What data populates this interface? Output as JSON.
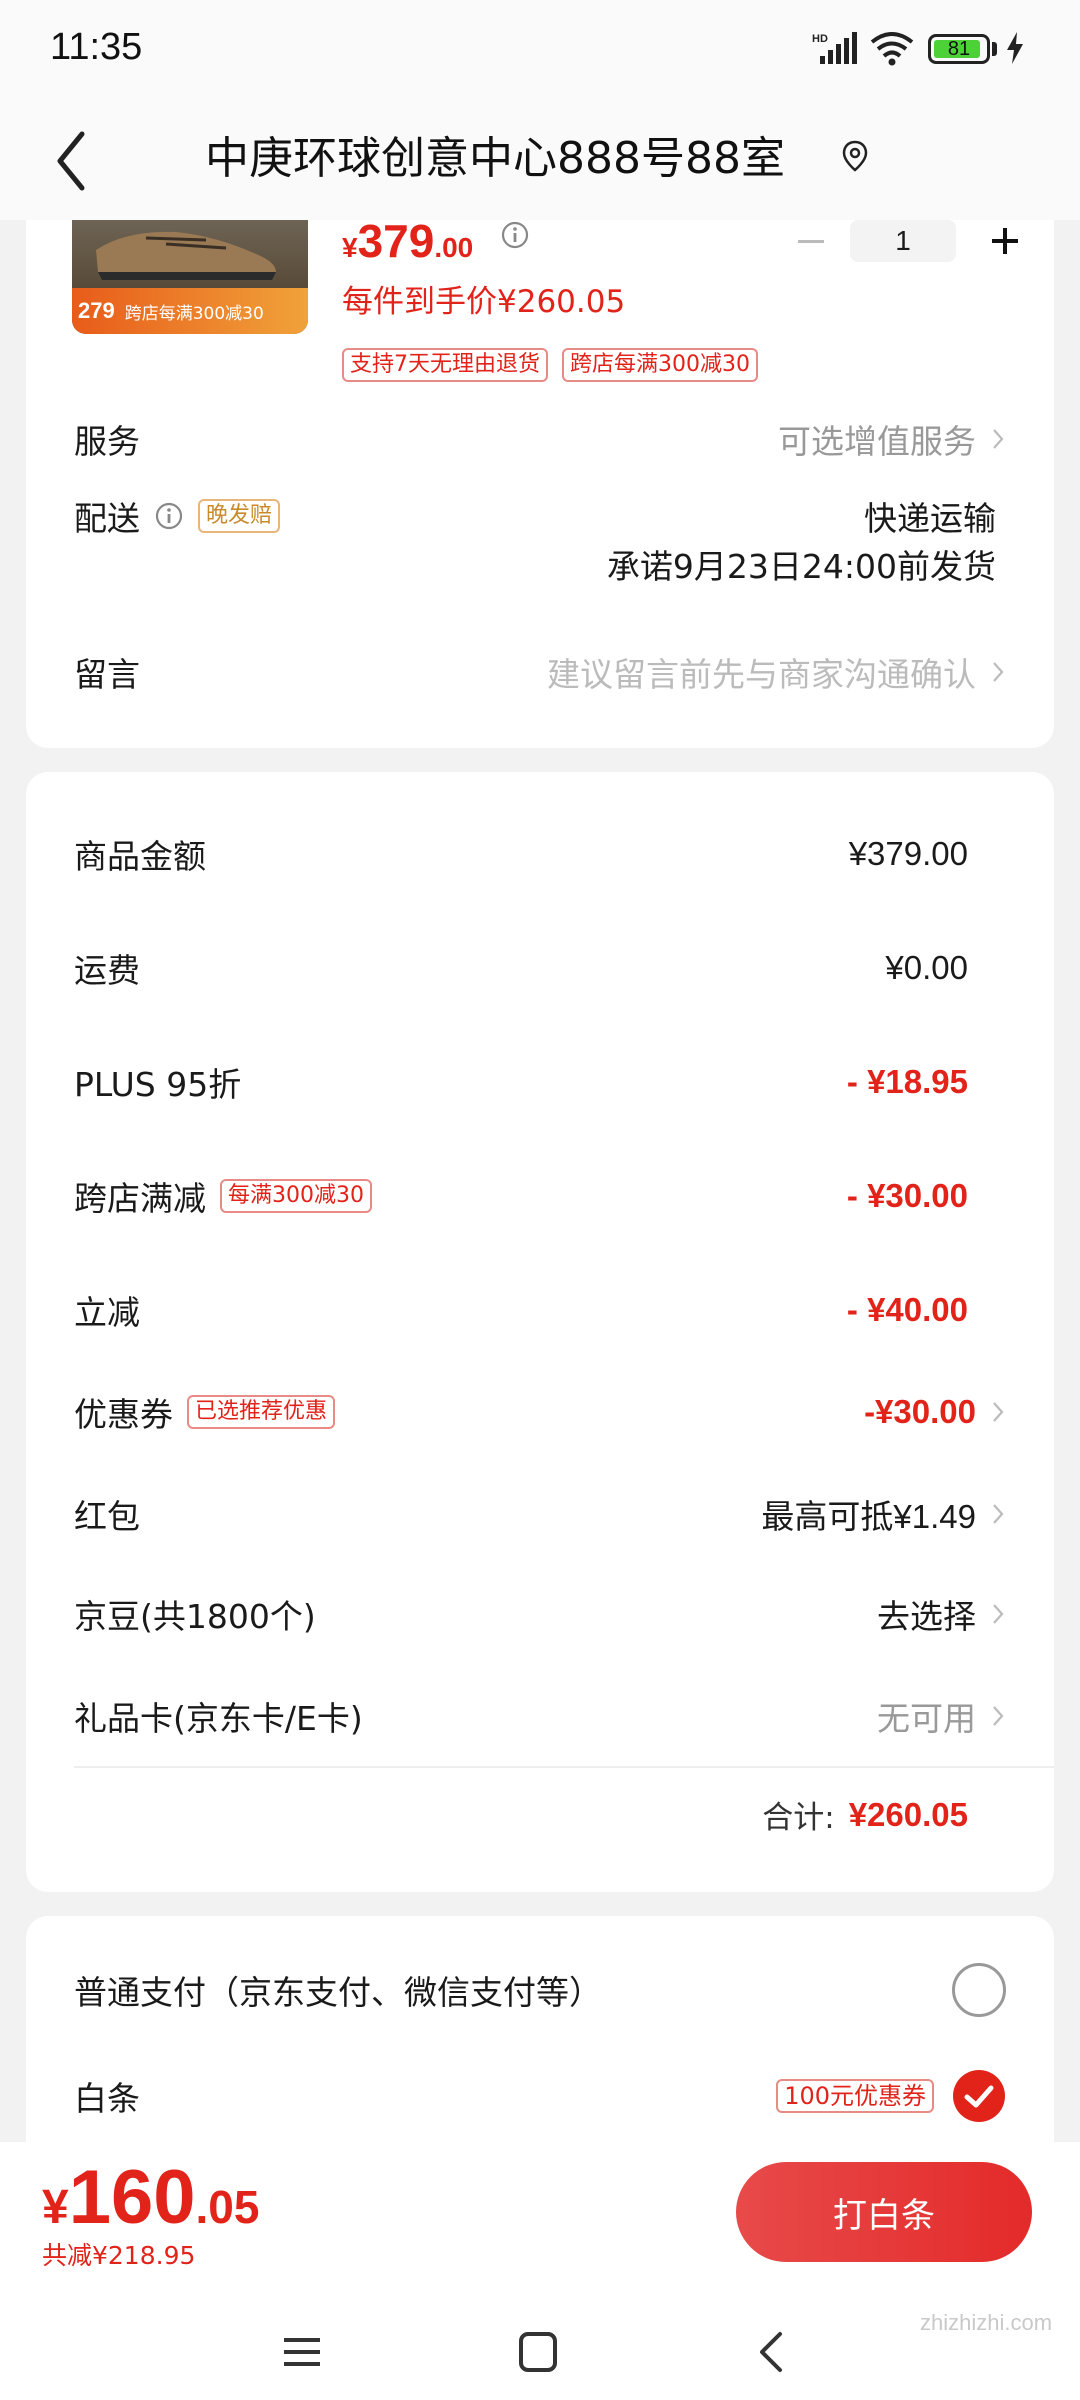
{
  "status_bar": {
    "time": "11:35",
    "battery": "81",
    "network": "HD"
  },
  "header": {
    "title": "中庚环球创意中心888号88室"
  },
  "product": {
    "banner_price": "279",
    "banner_promo": "跨店每满300减30",
    "price_currency": "¥",
    "price_int": "379",
    "price_dec": ".00",
    "unit_price": "每件到手价¥260.05",
    "quantity": "1",
    "tags": [
      "支持7天无理由退货",
      "跨店每满300减30"
    ]
  },
  "service": {
    "label": "服务",
    "value": "可选增值服务"
  },
  "delivery": {
    "label": "配送",
    "badge": "晚发赔",
    "method": "快递运输",
    "promise": "承诺9月23日24:00前发货"
  },
  "message": {
    "label": "留言",
    "placeholder": "建议留言前先与商家沟通确认"
  },
  "summary": {
    "goods_label": "商品金额",
    "goods_value": "¥379.00",
    "shipping_label": "运费",
    "shipping_value": "¥0.00",
    "plus_label": "PLUS 95折",
    "plus_value": "- ¥18.95",
    "cross_label": "跨店满减",
    "cross_tag": "每满300减30",
    "cross_value": "- ¥30.00",
    "instant_label": "立减",
    "instant_value": "- ¥40.00",
    "coupon_label": "优惠券",
    "coupon_tag": "已选推荐优惠",
    "coupon_value": "-¥30.00",
    "redpacket_label": "红包",
    "redpacket_value": "最高可抵¥1.49",
    "jingdou_label": "京豆(共1800个)",
    "jingdou_value": "去选择",
    "giftcard_label": "礼品卡(京东卡/E卡)",
    "giftcard_value": "无可用",
    "total_label": "合计:",
    "total_value": "¥260.05"
  },
  "payment": {
    "normal_label": "普通支付（京东支付、微信支付等）",
    "baitiao_label": "白条",
    "baitiao_tag": "100元优惠券",
    "normal_selected": false,
    "baitiao_selected": true
  },
  "bottom_bar": {
    "currency": "¥",
    "price_int": "160",
    "price_dec": ".05",
    "savings": "共减¥218.95",
    "pay_button": "打白条"
  },
  "watermark": "zhizhizhi.com",
  "colors": {
    "accent": "#e2231a",
    "background": "#f2f2f2",
    "card": "#ffffff"
  }
}
